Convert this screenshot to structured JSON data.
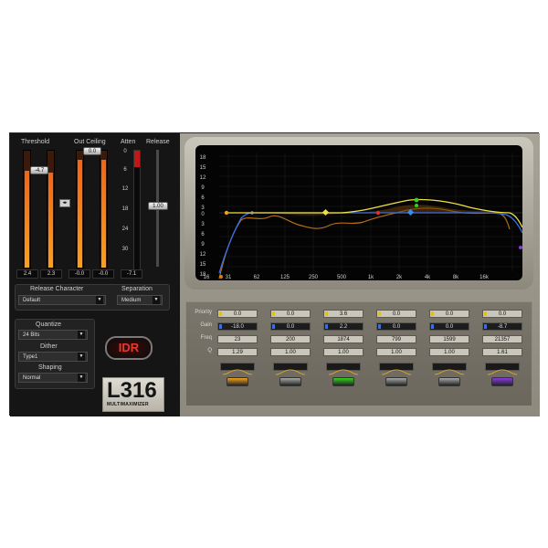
{
  "left": {
    "threshold": {
      "label": "Threshold",
      "value": "-4.7",
      "readouts": [
        "2.4",
        "2.3"
      ]
    },
    "out_ceiling": {
      "label": "Out Ceiling",
      "value": "0.0",
      "readouts": [
        "-0.0",
        "-0.0"
      ]
    },
    "atten": {
      "label": "Atten",
      "scale": [
        "0",
        "6",
        "12",
        "18",
        "24",
        "30"
      ],
      "readout": "-7.1"
    },
    "release": {
      "label": "Release",
      "value": "1.00"
    },
    "link_icon": "link-icon",
    "release_character": {
      "label": "Release Character",
      "value": "Default"
    },
    "separation": {
      "label": "Separation",
      "value": "Medium"
    },
    "quantize": {
      "label": "Quantize",
      "value": "24 Bits"
    },
    "dither": {
      "label": "Dither",
      "value": "Type1"
    },
    "shaping": {
      "label": "Shaping",
      "value": "Normal"
    },
    "idr_label": "IDR",
    "logo": {
      "main": "L316",
      "sub": "MULTIMAXIMIZER"
    }
  },
  "graph": {
    "y_ticks": [
      "18",
      "15",
      "12",
      "9",
      "6",
      "3",
      "0",
      "3",
      "6",
      "9",
      "12",
      "15",
      "18"
    ],
    "x_ticks": [
      "16",
      "31",
      "62",
      "125",
      "250",
      "500",
      "1k",
      "2k",
      "4k",
      "8k",
      "16k"
    ]
  },
  "bands": {
    "row_labels": [
      "Priority",
      "Gain",
      "Freq",
      "Q"
    ],
    "items": [
      {
        "priority": "0.0",
        "gain": "-18.0",
        "freq": "23",
        "q": "1.29",
        "color": "#f0a020"
      },
      {
        "priority": "0.0",
        "gain": "0.0",
        "freq": "200",
        "q": "1.00",
        "color": "#a8a8a8"
      },
      {
        "priority": "3.6",
        "gain": "2.2",
        "freq": "1874",
        "q": "1.00",
        "color": "#34d020"
      },
      {
        "priority": "0.0",
        "gain": "0.0",
        "freq": "799",
        "q": "1.00",
        "color": "#a8a8a8"
      },
      {
        "priority": "0.0",
        "gain": "0.0",
        "freq": "1599",
        "q": "1.00",
        "color": "#a8a8a8"
      },
      {
        "priority": "0.0",
        "gain": "-8.7",
        "freq": "21357",
        "q": "1.61",
        "color": "#8a3ae0"
      }
    ]
  },
  "colors": {
    "orange_meter": "#f7a21a",
    "eq_blue": "#3a6ee8",
    "eq_yellow": "#f0e040",
    "eq_orange": "#d08018"
  }
}
